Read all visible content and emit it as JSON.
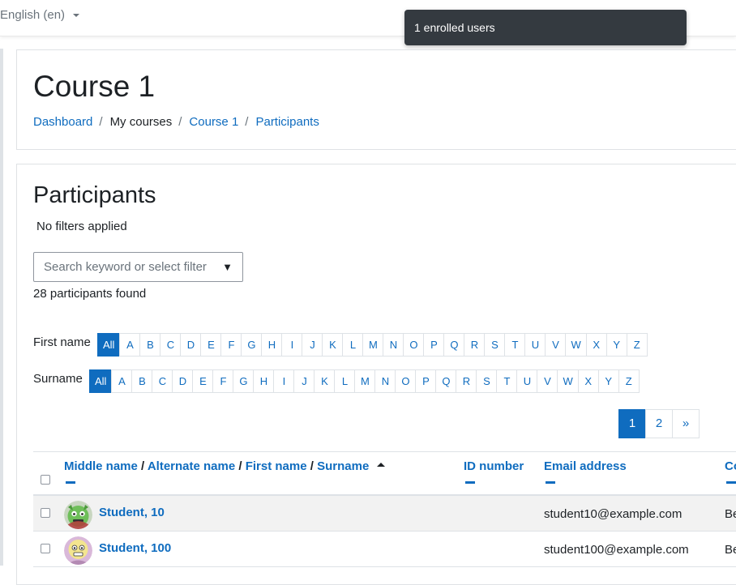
{
  "nav": {
    "language": "English (en)"
  },
  "toast": {
    "message": "1 enrolled users"
  },
  "header": {
    "title": "Course 1",
    "breadcrumb": [
      "Dashboard",
      "My courses",
      "Course 1",
      "Participants"
    ]
  },
  "participants": {
    "title": "Participants",
    "filters_status": "No filters applied",
    "search_placeholder": "Search keyword or select filter",
    "found_text": "28 participants found",
    "firstname_label": "First name",
    "surname_label": "Surname",
    "initials": [
      "All",
      "A",
      "B",
      "C",
      "D",
      "E",
      "F",
      "G",
      "H",
      "I",
      "J",
      "K",
      "L",
      "M",
      "N",
      "O",
      "P",
      "Q",
      "R",
      "S",
      "T",
      "U",
      "V",
      "W",
      "X",
      "Y",
      "Z"
    ],
    "active_initial": "All",
    "pages": [
      "1",
      "2",
      "»"
    ],
    "active_page": "1"
  },
  "table": {
    "headers": {
      "middle_name": "Middle name",
      "alternate_name": "Alternate name",
      "first_name": "First name",
      "surname": "Surname",
      "sep": "/",
      "id_number": "ID number",
      "email": "Email address",
      "next": "Co"
    },
    "rows": [
      {
        "name": "Student, 10",
        "email": "student10@example.com",
        "next": "Be"
      },
      {
        "name": "Student, 100",
        "email": "student100@example.com",
        "next": "Be"
      }
    ]
  }
}
